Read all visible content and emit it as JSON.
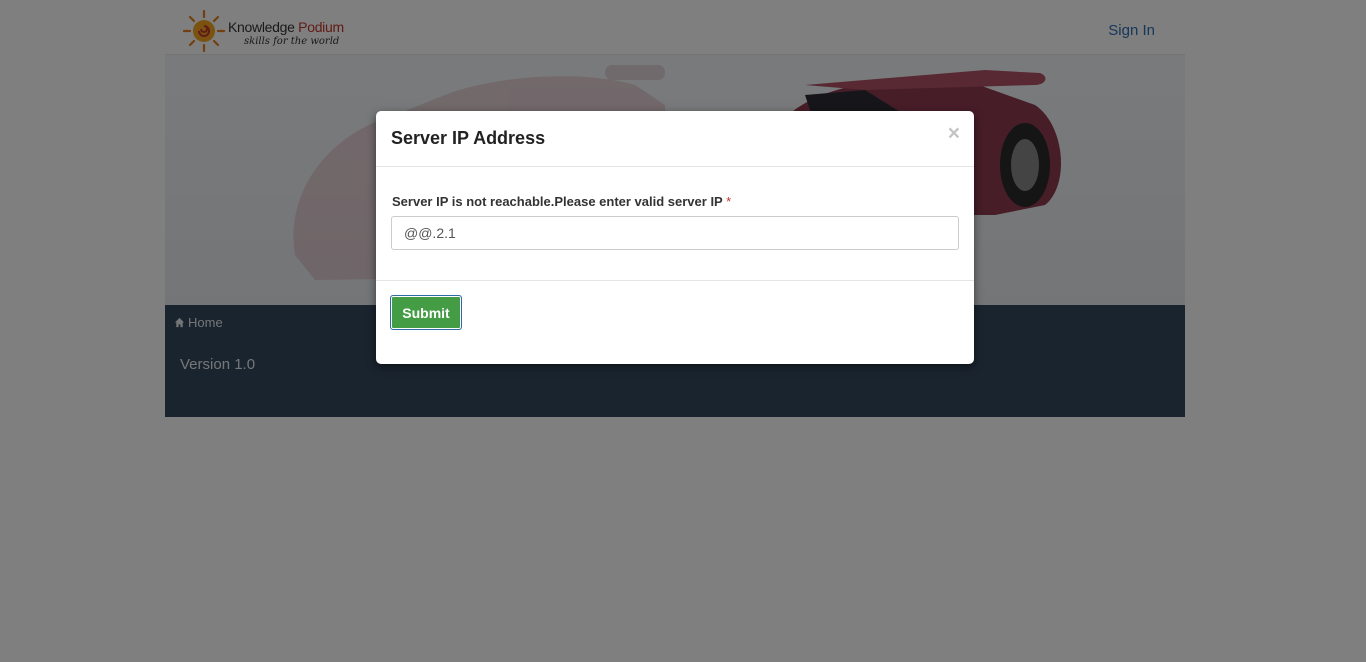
{
  "navbar": {
    "logo_name_part1": "Knowledge ",
    "logo_name_part2": "Podium",
    "logo_tagline": "skills for the world",
    "signin_label": "Sign In"
  },
  "footer": {
    "breadcrumb_home": "Home",
    "version_text": "Version 1.0"
  },
  "modal": {
    "title": "Server IP Address",
    "close_symbol": "×",
    "field_label": "Server IP is not reachable.Please enter valid server IP",
    "required_marker": "*",
    "input_value": "@@.2.1",
    "submit_label": "Submit"
  },
  "colors": {
    "footer_bg": "#34495e",
    "submit_bg": "#449d44",
    "link": "#2a6fb5",
    "required": "#c9302c"
  },
  "icons": [
    "sun-logo-icon",
    "home-icon",
    "close-icon"
  ]
}
